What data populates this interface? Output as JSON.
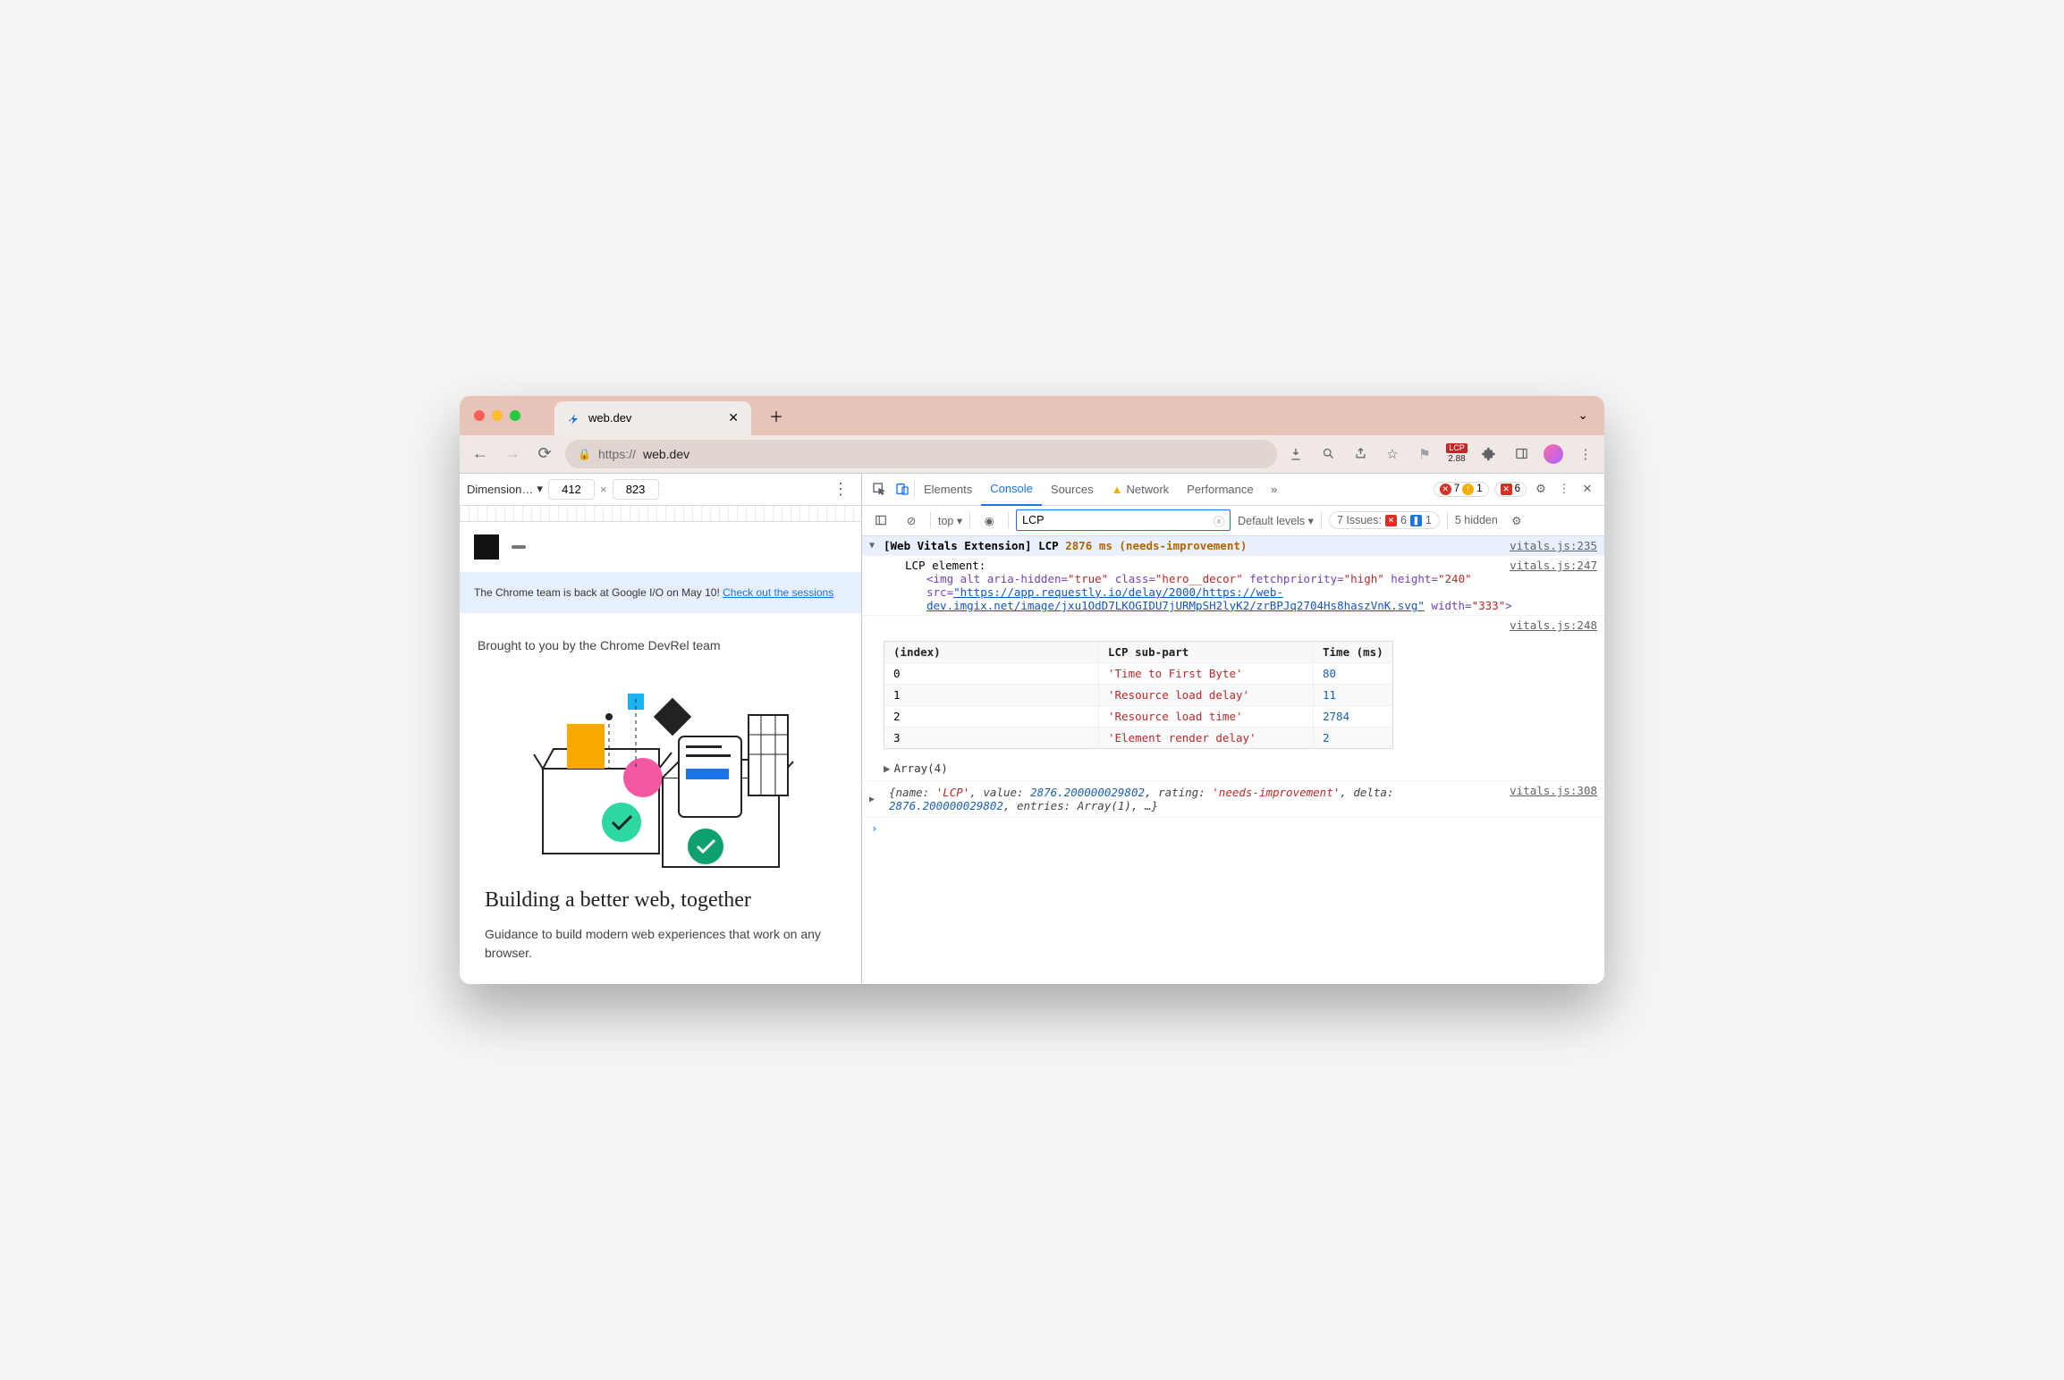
{
  "browser": {
    "tab_title": "web.dev",
    "url_scheme": "https://",
    "url_host": "web.dev",
    "lcp_badge": "LCP",
    "lcp_value": "2.88"
  },
  "deviceToolbar": {
    "label": "Dimension…",
    "width": "412",
    "sep": "×",
    "height": "823"
  },
  "page": {
    "banner_text": "The Chrome team is back at Google I/O on May 10! ",
    "banner_link": "Check out the sessions",
    "brought": "Brought to you by the Chrome DevRel team",
    "heading": "Building a better web, together",
    "sub": "Guidance to build modern web experiences that work on any browser."
  },
  "devtools": {
    "tabs": [
      "Elements",
      "Console",
      "Sources",
      "Network",
      "Performance"
    ],
    "active_tab": "Console",
    "errors": "7",
    "warns": "1",
    "blocked_label": "6",
    "settings_hidden": "5 hidden",
    "ctx_label": "top",
    "filter_value": "LCP",
    "levels_label": "Default levels",
    "issues_label": "7 Issues:",
    "issues_err": "6",
    "issues_info": "1"
  },
  "console": {
    "line1": {
      "prefix": "[Web Vitals Extension] LCP",
      "value": "2876 ms (needs-improvement)",
      "src": "vitals.js:235"
    },
    "line2": {
      "label": "LCP element:",
      "src": "vitals.js:247",
      "html_pre": "<img alt aria-hidden=",
      "true": "\"true\"",
      "class_k": " class=",
      "class_v": "\"hero__decor\"",
      "fp_k": " fetchpriority=",
      "fp_v": "\"high\"",
      "h_k": " height=",
      "h_v": "\"240\"",
      "src_k": " src=",
      "src_url": "\"https://app.requestly.io/delay/2000/https://web-dev.imgix.net/image/jxu1OdD7LKOGIDU7jURMpSH2lyK2/zrBPJq2704Hs8haszVnK.svg\"",
      "w_k": " width=",
      "w_v": "\"333\"",
      "close": ">"
    },
    "table_src": "vitals.js:248",
    "table": {
      "headers": [
        "(index)",
        "LCP sub-part",
        "Time (ms)"
      ],
      "rows": [
        {
          "i": "0",
          "label": "'Time to First Byte'",
          "ms": "80"
        },
        {
          "i": "1",
          "label": "'Resource load delay'",
          "ms": "11"
        },
        {
          "i": "2",
          "label": "'Resource load time'",
          "ms": "2784"
        },
        {
          "i": "3",
          "label": "'Element render delay'",
          "ms": "2"
        }
      ],
      "footer": "Array(4)"
    },
    "obj": {
      "src": "vitals.js:308",
      "text_pre": "{name: ",
      "name": "'LCP'",
      "val_k": ", value: ",
      "val": "2876.200000029802",
      "rating_k": ", rating: ",
      "rating": "'needs-improvement'",
      "delta_k": ", delta: ",
      "delta": "2876.200000029802",
      "entries_k": ", entries: ",
      "entries": "Array(1)",
      "tail": ", …}"
    }
  }
}
